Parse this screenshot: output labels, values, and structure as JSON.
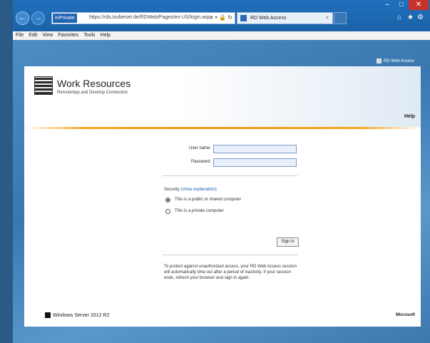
{
  "browser": {
    "inprivate_label": "InPrivate",
    "url": "https://rds.tsvbeisel.de/RDWeb/Pages/en-US/login.aspx",
    "addr_controls": "⌕ ▾ 🔒 ↻",
    "tab_title": "RD Web Access",
    "tab_close": "×",
    "back_icon": "←",
    "forward_icon": "→",
    "home_icon": "⌂",
    "fav_icon": "★",
    "settings_icon": "⚙",
    "minimize": "–",
    "maximize": "□",
    "close": "✕",
    "menu": [
      "File",
      "Edit",
      "View",
      "Favorites",
      "Tools",
      "Help"
    ]
  },
  "rdwa_link": "RD Web Access",
  "header": {
    "title": "Work Resources",
    "subtitle": "RemoteApp and Desktop Connection",
    "help": "Help"
  },
  "login": {
    "username_label": "User name:",
    "password_label": "Password:",
    "username_value": "",
    "password_value": "",
    "security_prefix": "Security ",
    "security_link": "(show explanation)",
    "option_public": "This is a public or shared computer",
    "option_private": "This is a private computer",
    "signin": "Sign in",
    "note": "To protect against unauthorized access, your RD Web Access session will automatically time out after a period of inactivity. If your session ends, refresh your browser and sign in again."
  },
  "footer": {
    "brand": "Windows Server 2012 R2",
    "vendor": "Microsoft"
  }
}
